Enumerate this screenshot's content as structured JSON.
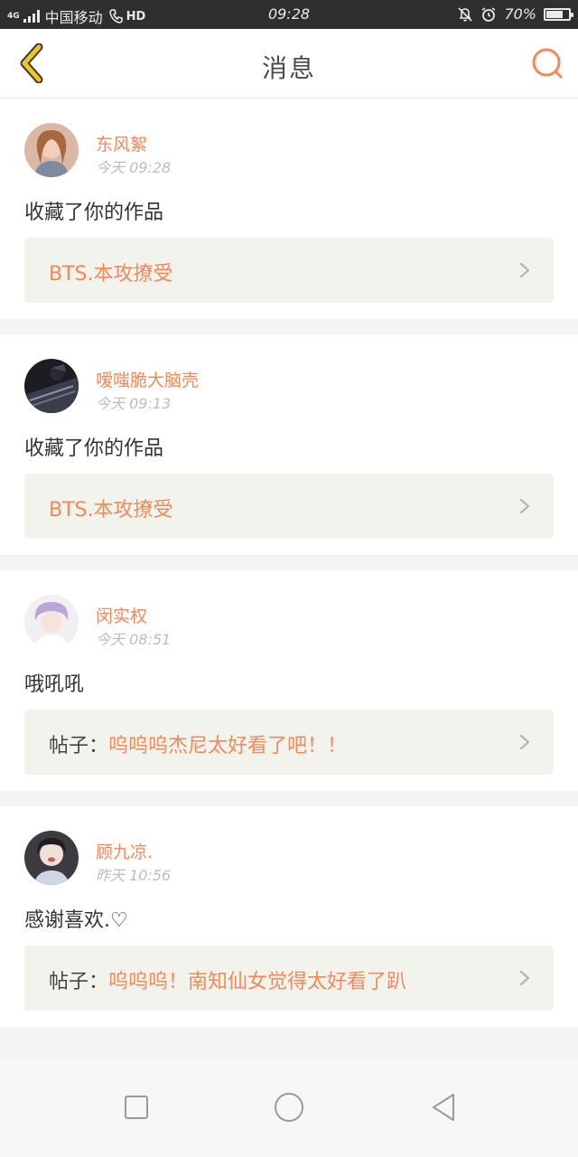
{
  "status_bar": {
    "network": "4G",
    "carrier": "中国移动",
    "volte": "HD",
    "time": "09:28",
    "battery": "70%",
    "battery_level": 0.7,
    "icons": [
      "signal-icon",
      "call-icon",
      "mute-bell-icon",
      "alarm-icon",
      "battery-icon"
    ]
  },
  "header": {
    "title": "消息",
    "back_icon": "chevron-left-icon",
    "search_icon": "search-icon"
  },
  "colors": {
    "accent": "#f08a5a",
    "back_arrow": "#f5c518",
    "ref_background": "#f3f3ee",
    "muted_text": "#bdbdbd"
  },
  "messages": [
    {
      "username": "东风絮",
      "time": "今天 09:28",
      "text": "收藏了你的作品",
      "ref_prefix": "",
      "ref_text": "BTS.本攻撩受"
    },
    {
      "username": "嗳嗤脆大脑壳",
      "time": "今天 09:13",
      "text": "收藏了你的作品",
      "ref_prefix": "",
      "ref_text": "BTS.本攻撩受"
    },
    {
      "username": "闵实权",
      "time": "今天 08:51",
      "text": "哦吼吼",
      "ref_prefix": "帖子：",
      "ref_text": "呜呜呜杰尼太好看了吧！！"
    },
    {
      "username": "顾九凉.",
      "time": "昨天 10:56",
      "text": "感谢喜欢.♡",
      "ref_prefix": "帖子：",
      "ref_text": "呜呜呜！南知仙女觉得太好看了趴"
    }
  ],
  "nav_bar": {
    "icons": [
      "recent-apps-icon",
      "home-icon",
      "back-icon"
    ]
  }
}
